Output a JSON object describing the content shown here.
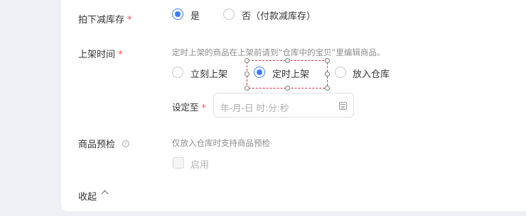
{
  "inventory": {
    "label": "拍下减库存",
    "required_mark": "*",
    "options": [
      "是",
      "否（付款减库存）"
    ],
    "selected": "是"
  },
  "listing_time": {
    "label": "上架时间",
    "required_mark": "*",
    "hint": "定时上架的商品在上架前请到“仓库中的宝贝”里编辑商品。",
    "options": [
      "立刻上架",
      "定时上架",
      "放入仓库"
    ],
    "selected": "定时上架"
  },
  "schedule": {
    "label": "设定至",
    "required_mark": "*",
    "placeholder": "年-月-日 时:分:秒",
    "icon": "calendar-icon"
  },
  "precheck": {
    "label": "商品预检",
    "help_icon": "?",
    "hint": "仅放入仓库时支持商品预检",
    "checkbox_label": "启用"
  },
  "collapse": {
    "label": "收起"
  },
  "colors": {
    "accent": "#3d7bff",
    "required": "#ff4d4f",
    "selection_border": "#d9363e"
  }
}
